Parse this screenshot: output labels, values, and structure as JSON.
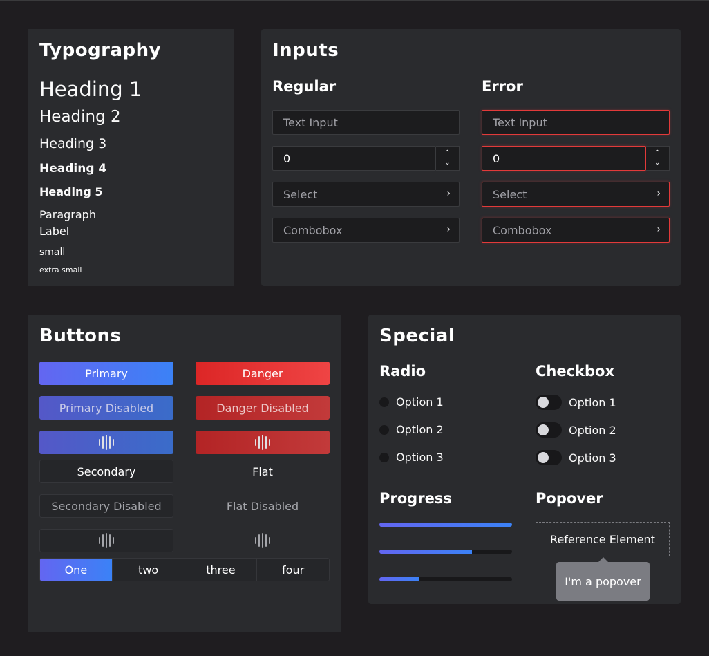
{
  "colors": {
    "background": "#1f1d20",
    "card": "#2a2b2e",
    "primary_start": "#6366f1",
    "primary_end": "#3b82f6",
    "danger": "#dc2626",
    "error_border": "#e23a3a"
  },
  "typography": {
    "title": "Typography",
    "h1": "Heading 1",
    "h2": "Heading 2",
    "h3": "Heading 3",
    "h4": "Heading 4",
    "h5": "Heading 5",
    "paragraph": "Paragraph",
    "label": "Label",
    "small": "small",
    "extra_small": "extra small"
  },
  "inputs": {
    "title": "Inputs",
    "regular": {
      "title": "Regular",
      "text_placeholder": "Text Input",
      "number_value": "0",
      "select_placeholder": "Select",
      "combobox_placeholder": "Combobox"
    },
    "error": {
      "title": "Error",
      "text_placeholder": "Text Input",
      "number_value": "0",
      "select_placeholder": "Select",
      "combobox_placeholder": "Combobox"
    }
  },
  "buttons": {
    "title": "Buttons",
    "primary": "Primary",
    "primary_disabled": "Primary Disabled",
    "danger": "Danger",
    "danger_disabled": "Danger Disabled",
    "secondary": "Secondary",
    "secondary_disabled": "Secondary Disabled",
    "flat": "Flat",
    "flat_disabled": "Flat Disabled",
    "segments": [
      "One",
      "two",
      "three",
      "four"
    ],
    "active_segment": "One",
    "loading_icon": "audio-wave-icon"
  },
  "special": {
    "title": "Special",
    "radio": {
      "title": "Radio",
      "options": [
        "Option 1",
        "Option 2",
        "Option 3"
      ]
    },
    "checkbox": {
      "title": "Checkbox",
      "options": [
        "Option 1",
        "Option 2",
        "Option 3"
      ]
    },
    "progress": {
      "title": "Progress",
      "values": [
        1.0,
        0.7,
        0.3
      ]
    },
    "popover": {
      "title": "Popover",
      "reference": "Reference Element",
      "content": "I'm a popover"
    }
  }
}
